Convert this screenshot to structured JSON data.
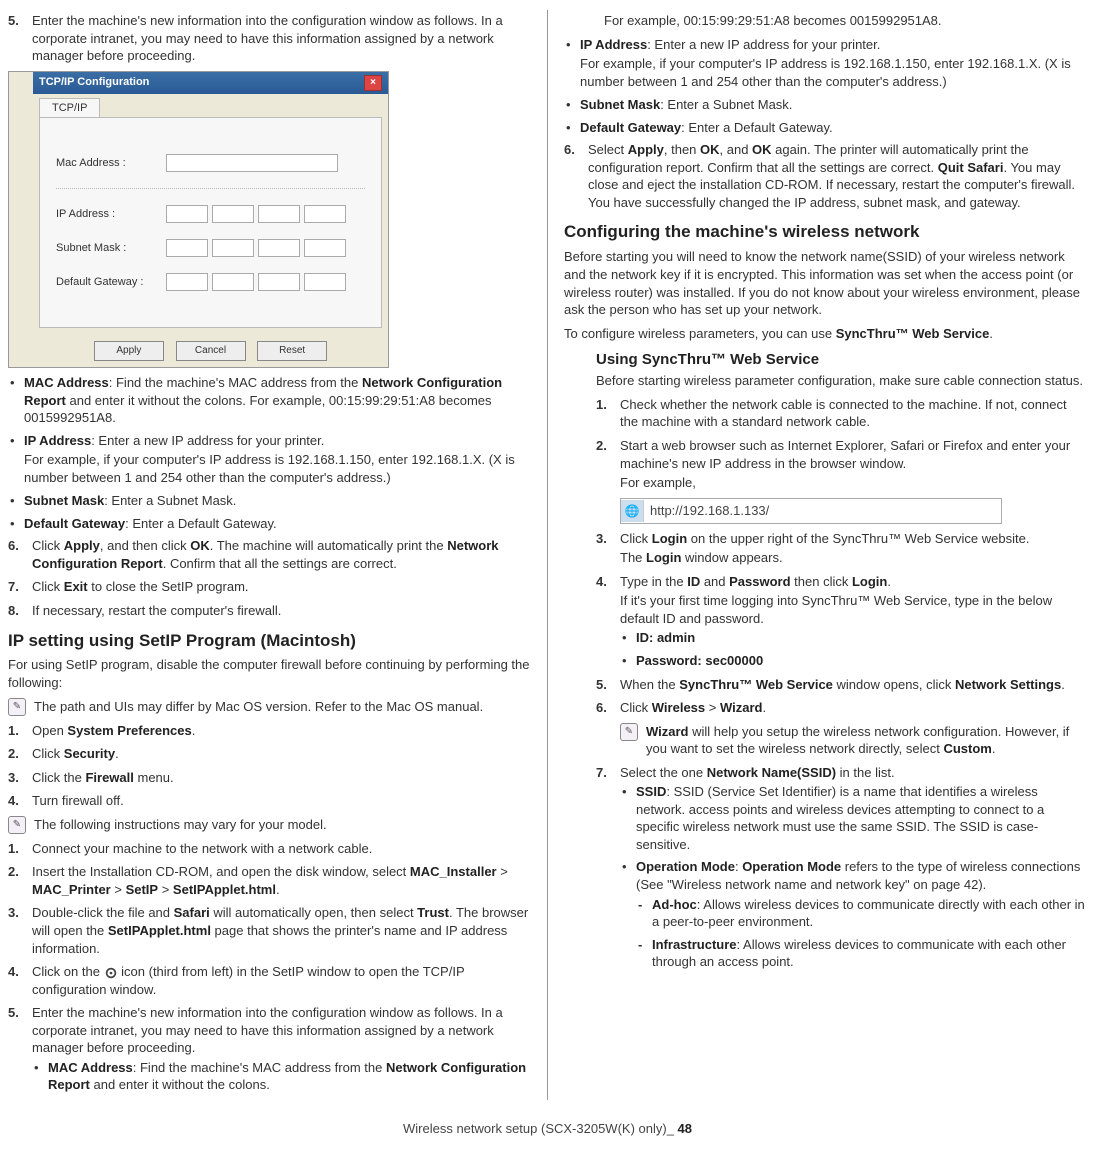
{
  "col1": {
    "step5": {
      "num": "5.",
      "text_a": "Enter the machine's new information into the configuration window as follows. In a corporate intranet, you may need to have this information assigned by a network manager before proceeding."
    },
    "tcpip_window": {
      "title": "TCP/IP Configuration",
      "tab": "TCP/IP",
      "fields": {
        "mac": "Mac Address :",
        "ip": "IP Address :",
        "subnet": "Subnet Mask :",
        "gateway": "Default Gateway :"
      },
      "buttons": {
        "apply": "Apply",
        "cancel": "Cancel",
        "reset": "Reset"
      }
    },
    "bullets1": {
      "mac_b": "MAC Address",
      "mac_rest": ": Find the machine's MAC address from the ",
      "mac_b2": "Network Configuration Report",
      "mac_rest2": " and enter it without the colons. For example, 00:15:99:29:51:A8 becomes 0015992951A8.",
      "ip_b": "IP Address",
      "ip_rest": ": Enter a new IP address for your printer.",
      "ip_p2": "For example, if your computer's IP address is 192.168.1.150, enter 192.168.1.X. (X is number between 1 and 254 other than the computer's address.)",
      "sub_b": "Subnet Mask",
      "sub_rest": ": Enter a Subnet Mask.",
      "gw_b": "Default Gateway",
      "gw_rest": ": Enter a Default Gateway."
    },
    "step6": {
      "num": "6.",
      "a": "Click ",
      "b1": "Apply",
      "c": ", and then click ",
      "b2": "OK",
      "d": ". The machine will automatically print the ",
      "b3": "Network Configuration Report",
      "e": ". Confirm that all the settings are correct."
    },
    "step7": {
      "num": "7.",
      "a": "Click ",
      "b": "Exit",
      "c": " to close the SetIP program."
    },
    "step8": {
      "num": "8.",
      "text": "If necessary, restart the computer's firewall."
    },
    "h_mac": "IP setting using SetIP Program (Macintosh)",
    "p_mac": "For using SetIP program, disable the computer firewall before continuing by performing the following:",
    "note1": "The path and UIs may differ by Mac OS version. Refer to the Mac OS manual.",
    "mac_steps": {
      "s1n": "1.",
      "s1a": "Open ",
      "s1b": "System Preferences",
      "s1c": ".",
      "s2n": "2.",
      "s2a": "Click ",
      "s2b": "Security",
      "s2c": ".",
      "s3n": "3.",
      "s3a": "Click the ",
      "s3b": "Firewall",
      "s3c": " menu.",
      "s4n": "4.",
      "s4": "Turn firewall off."
    },
    "note2": "The following instructions may vary for your model.",
    "mac2": {
      "s1n": "1.",
      "s1": "Connect your machine to the network with a network cable.",
      "s2n": "2.",
      "s2a": "Insert the Installation CD-ROM, and open the disk window, select ",
      "s2b1": "MAC_Installer",
      "s2s1": " > ",
      "s2b2": "MAC_Printer",
      "s2s2": " > ",
      "s2b3": "SetIP",
      "s2s3": " > ",
      "s2b4": "SetIPApplet.html",
      "s2e": ".",
      "s3n": "3.",
      "s3a": "Double-click the file and ",
      "s3b1": "Safari",
      "s3c": " will automatically open, then select ",
      "s3b2": "Trust",
      "s3d": ". The browser will open the ",
      "s3b3": "SetIPApplet.html",
      "s3e": " page that shows the printer's name and IP address information.",
      "s4n": "4.",
      "s4a": "Click on the ",
      "s4c": " icon (third from left) in the SetIP window to open the TCP/IP configuration window.",
      "s5n": "5.",
      "s5": "Enter the machine's new information into the configuration window as follows. In a corporate intranet, you may need to have this information assigned by a network manager before proceeding.",
      "s5_mac_b": "MAC Address",
      "s5_mac_rest": ": Find the machine's MAC address from the ",
      "s5_mac_b2": "Network Configuration Report",
      "s5_mac_rest2": " and enter it without the colons."
    }
  },
  "col2": {
    "cont": {
      "p1": "For example, 00:15:99:29:51:A8 becomes 0015992951A8.",
      "ip_b": "IP Address",
      "ip_rest": ": Enter a new IP address for your printer.",
      "ip_p2": "For example, if your computer's IP address is 192.168.1.150, enter 192.168.1.X. (X is number between 1 and 254 other than the computer's address.)",
      "sub_b": "Subnet Mask",
      "sub_rest": ": Enter a Subnet Mask.",
      "gw_b": "Default Gateway",
      "gw_rest": ": Enter a Default Gateway."
    },
    "step6": {
      "num": "6.",
      "a": "Select ",
      "b1": "Apply",
      "c": ", then ",
      "b2": "OK",
      "d": ", and ",
      "b3": "OK",
      "e": " again. The printer will automatically print the configuration report. Confirm that all the settings are correct. ",
      "b4": "Quit Safari",
      "f": ". You may close and eject the installation CD-ROM. If necessary, restart the computer's firewall. You have successfully changed the IP address, subnet mask, and gateway."
    },
    "h_wireless": "Configuring the machine's wireless network",
    "p_w1": "Before starting you will need to know the network name(SSID) of your wireless network and the network key if it is encrypted. This information was set when the access point (or wireless router) was installed. If you do not know about your wireless environment, please ask the person who has set up your network.",
    "p_w2a": "To configure wireless parameters, you can use ",
    "p_w2b": "SyncThru™ Web Service",
    "p_w2c": ".",
    "h_sync": "Using SyncThru™ Web Service",
    "p_sync": "Before starting wireless parameter configuration, make sure cable connection status.",
    "sync_steps": {
      "s1n": "1.",
      "s1": "Check whether the network cable is connected to the machine. If not, connect the machine with a standard network cable.",
      "s2n": "2.",
      "s2": "Start a web browser such as Internet Explorer, Safari or Firefox and enter your machine's new IP address in the browser window.",
      "s2b": "For example,",
      "url": "http://192.168.1.133/",
      "s3n": "3.",
      "s3a": "Click ",
      "s3b": "Login",
      "s3c": " on the upper right of the SyncThru™ Web Service website.",
      "s3d": "The ",
      "s3e": "Login",
      "s3f": " window appears.",
      "s4n": "4.",
      "s4a": "Type in the ",
      "s4b1": "ID",
      "s4c": " and ",
      "s4b2": "Password",
      "s4d": " then click ",
      "s4b3": "Login",
      "s4e": ".",
      "s4f": "If it's your first time logging into SyncThru™ Web Service, type in the below default ID and password.",
      "id_lbl": "ID:  ",
      "id_val": "admin",
      "pw_lbl": "Password:  ",
      "pw_val": "sec00000",
      "s5n": "5.",
      "s5a": "When the ",
      "s5b1": "SyncThru™ Web Service",
      "s5c": " window opens, click ",
      "s5b2": "Network Settings",
      "s5d": ".",
      "s6n": "6.",
      "s6a": "Click ",
      "s6b1": "Wireless",
      "s6c": " > ",
      "s6b2": "Wizard",
      "s6d": ".",
      "note_b": "Wizard",
      "note_rest": " will help you setup the wireless network configuration. However, if you want to set the wireless network directly, select ",
      "note_b2": "Custom",
      "note_rest2": ".",
      "s7n": "7.",
      "s7a": "Select the one ",
      "s7b": "Network Name(SSID)",
      "s7c": " in the list.",
      "ssid_b": "SSID",
      "ssid_rest": ": SSID (Service Set Identifier) is a name that identifies a wireless network. access points and wireless devices attempting to connect to a specific wireless network must use the same SSID. The SSID is case-sensitive.",
      "op_b": "Operation Mode",
      "op_c": ": ",
      "op_b2": "Operation Mode",
      "op_rest": " refers to the type of wireless connections (See \"Wireless network name and network key\" on page 42).",
      "adhoc_b": "Ad-hoc",
      "adhoc_rest": ": Allows wireless devices to communicate directly with each other in a peer-to-peer environment.",
      "infra_b": "Infrastructure",
      "infra_rest": ": Allows wireless devices to communicate with each other through an access point."
    }
  },
  "footer": {
    "a": "Wireless network setup (SCX-3205W(K) only)_ ",
    "b": "48"
  }
}
